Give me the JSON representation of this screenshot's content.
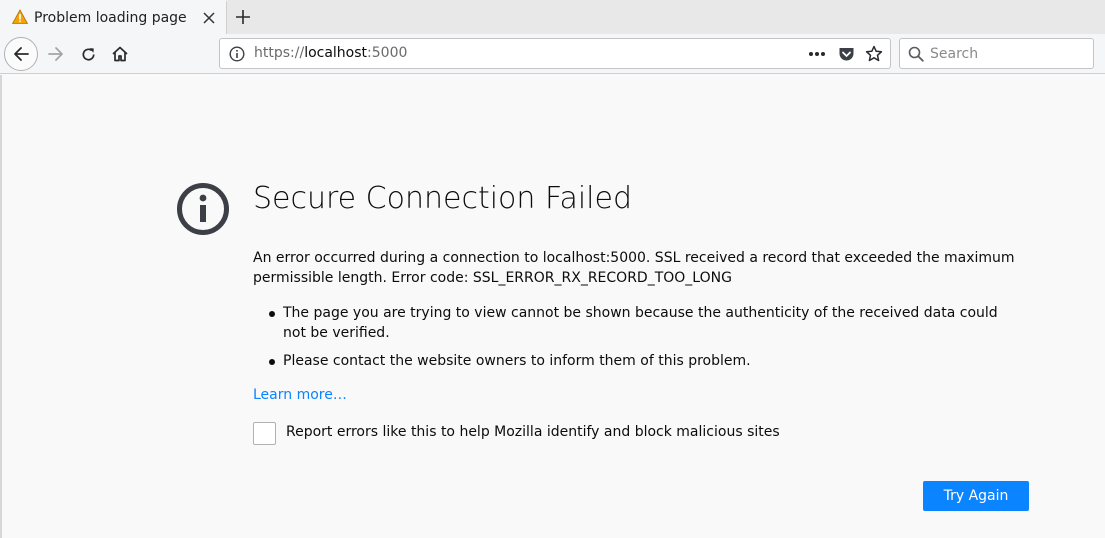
{
  "tab": {
    "title": "Problem loading page",
    "icon": "warning-icon",
    "close_icon": "close-icon"
  },
  "newtab": {
    "icon": "plus-icon"
  },
  "nav": {
    "back_icon": "back-arrow-icon",
    "forward_icon": "forward-arrow-icon",
    "reload_icon": "reload-icon",
    "home_icon": "home-icon"
  },
  "urlbar": {
    "scheme": "https://",
    "host": "localhost",
    "port": ":5000",
    "page_actions_icon": "more-icon",
    "pocket_icon": "pocket-icon",
    "bookmark_icon": "star-icon"
  },
  "search": {
    "placeholder": "Search"
  },
  "error": {
    "title": "Secure Connection Failed",
    "description": "An error occurred during a connection to localhost:5000. SSL received a record that exceeded the maximum permissible length. Error code: SSL_ERROR_RX_RECORD_TOO_LONG",
    "bullets": [
      "The page you are trying to view cannot be shown because the authenticity of the received data could not be verified.",
      "Please contact the website owners to inform them of this problem."
    ],
    "learn_more": "Learn more…",
    "report_label": "Report errors like this to help Mozilla identify and block malicious sites",
    "report_checked": false,
    "try_again": "Try Again"
  },
  "colors": {
    "accent": "#0a84ff",
    "warning": "#f0a30a",
    "icon": "#3c3f45",
    "page_bg": "#f9f9fa"
  }
}
